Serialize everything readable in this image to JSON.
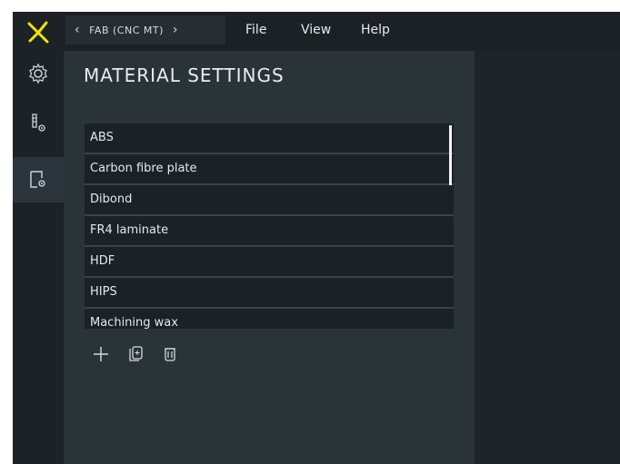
{
  "breadcrumb": {
    "label": "FAB (CNC MT)"
  },
  "menu": {
    "items": [
      "File",
      "View",
      "Help"
    ]
  },
  "panel": {
    "title": "MATERIAL SETTINGS"
  },
  "materials": [
    "ABS",
    "Carbon fibre plate",
    "Dibond",
    "FR4 laminate",
    "HDF",
    "HIPS",
    "Machining wax"
  ],
  "colors": {
    "accent": "#f2e600",
    "panel": "#2a3338",
    "rail": "#1c2226"
  },
  "icons": {
    "logo": "x-logo-icon",
    "settings": "gear-icon",
    "machine": "machine-settings-icon",
    "material": "material-settings-icon",
    "add": "plus-icon",
    "duplicate": "duplicate-icon",
    "delete": "trash-icon"
  }
}
